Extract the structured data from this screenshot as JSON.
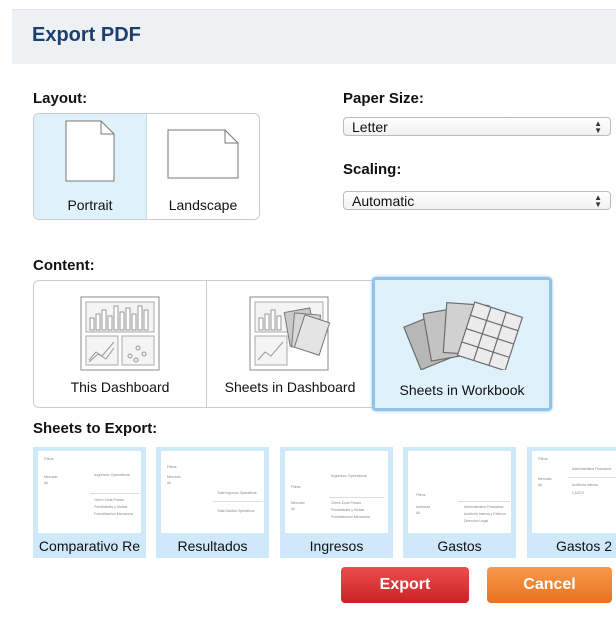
{
  "dialog": {
    "title": "Export PDF"
  },
  "layout": {
    "label": "Layout:",
    "options": [
      {
        "label": "Portrait",
        "selected": true
      },
      {
        "label": "Landscape",
        "selected": false
      }
    ]
  },
  "paper_size": {
    "label": "Paper Size:",
    "value": "Letter"
  },
  "scaling": {
    "label": "Scaling:",
    "value": "Automatic"
  },
  "content": {
    "label": "Content:",
    "options": [
      {
        "label": "This Dashboard",
        "selected": false
      },
      {
        "label": "Sheets in Dashboard",
        "selected": false
      },
      {
        "label": "Sheets in Workbook",
        "selected": true
      }
    ]
  },
  "sheets": {
    "label": "Sheets to Export:",
    "items": [
      {
        "label": "Comparativo Re",
        "t1": "Ingresos Operativos",
        "t2": "Filtros",
        "t3": "Mercado",
        "t4": "All",
        "r1": "Cierre Zona Franco",
        "r2": "Penalidades y Multas",
        "r3": "Formalizacion Mercancia"
      },
      {
        "label": "Resultados",
        "t1": "Total Ingresos Operativos",
        "t2": "Filtros",
        "t3": "Mercado",
        "t4": "All",
        "r1": "Total Gastos Operativos",
        "r2": "",
        "r3": ""
      },
      {
        "label": "Ingresos",
        "t1": "Ingresos Operativos",
        "t2": "Filtros",
        "t3": "Mercado",
        "t4": "All",
        "r1": "Cierre Zona Franco",
        "r2": "Penalidades y Multas",
        "r3": "Formalizacion Mercancia"
      },
      {
        "label": "Gastos",
        "t1": "Filtros",
        "t2": "Actividad",
        "t3": "All",
        "t4": "",
        "r1": "Administrativa Financiera",
        "r2": "Auditoria Interna y Externa",
        "r3": "Direccion Legal"
      },
      {
        "label": "Gastos 2",
        "t1": "Filtros",
        "t2": "Mercado",
        "t3": "All",
        "t4": "",
        "r1": "Administrativa Financiera",
        "r2": "Auditoria Interna",
        "r3": "CACEX"
      }
    ]
  },
  "buttons": {
    "export": "Export",
    "cancel": "Cancel"
  },
  "colors": {
    "title": "#1c3f6e",
    "selected_bg": "#dff2fc",
    "selected_border": "#8fc3ea",
    "export": "#d93434",
    "cancel": "#f08535"
  }
}
